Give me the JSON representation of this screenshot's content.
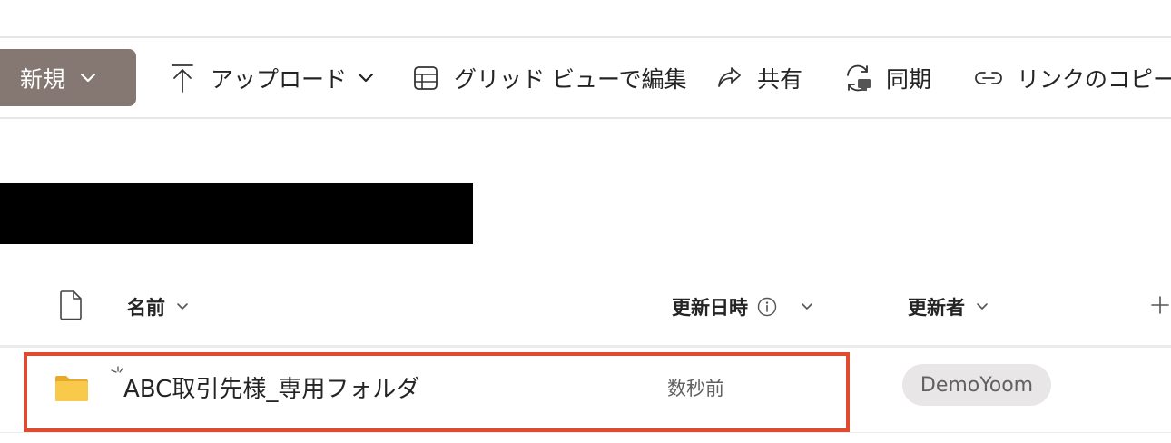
{
  "toolbar": {
    "new_label": "新規",
    "upload_label": "アップロード",
    "grid_view_label": "グリッド ビューで編集",
    "share_label": "共有",
    "sync_label": "同期",
    "copy_link_label": "リンクのコピー"
  },
  "list": {
    "header": {
      "name": "名前",
      "modified": "更新日時",
      "modified_by": "更新者"
    },
    "rows": [
      {
        "name": "ABC取引先様_専用フォルダ",
        "modified": "数秒前",
        "modified_by": "DemoYoom"
      }
    ]
  },
  "colors": {
    "new_button_bg": "#857872",
    "highlight_border": "#e04a2e",
    "folder_yellow": "#f8c94a"
  }
}
